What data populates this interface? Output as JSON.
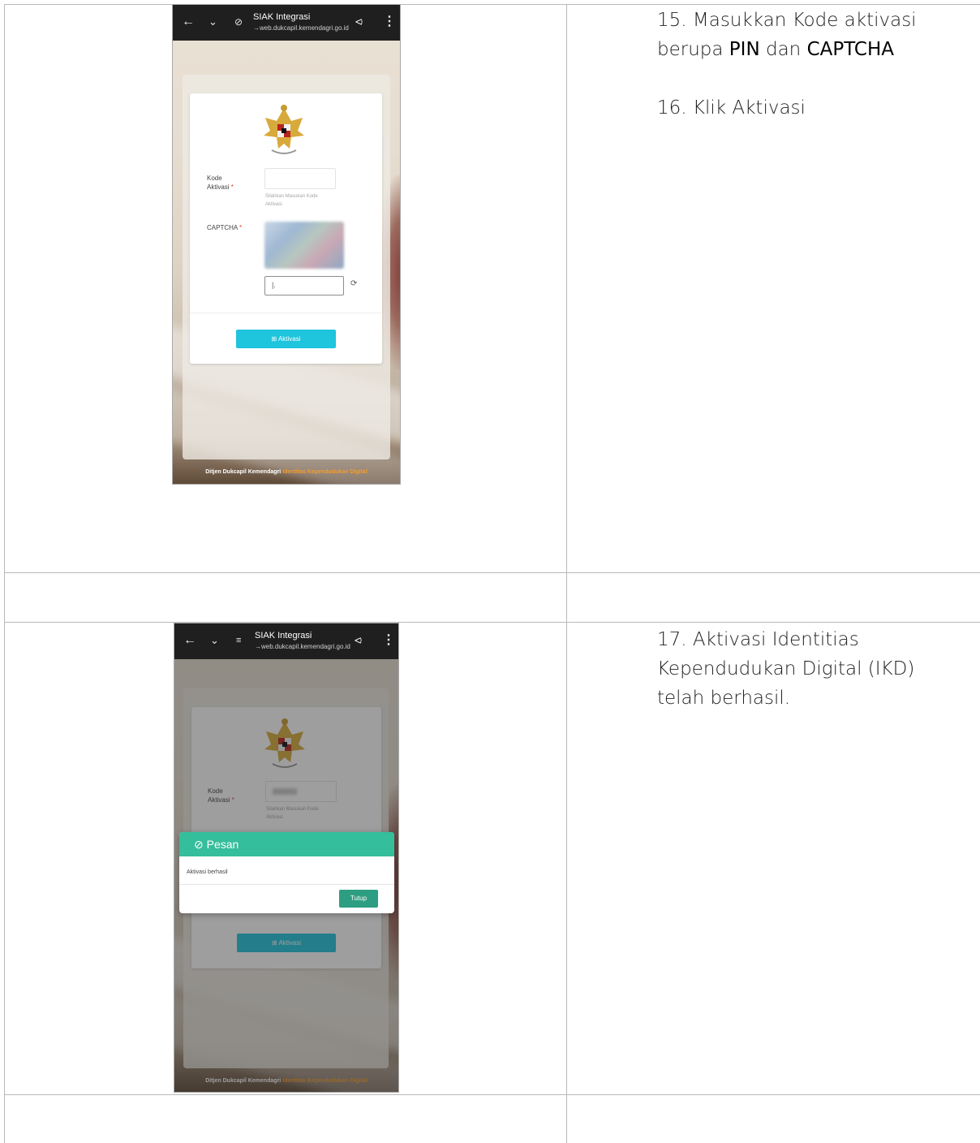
{
  "steps": {
    "s15_prefix": "15. Masukkan Kode aktivasi",
    "s15_line2_a": "berupa",
    "s15_pin": "PIN",
    "s15_and": "dan",
    "s15_captcha": "CAPTCHA",
    "s16": "16. Klik Aktivasi",
    "s17_line1": "17. Aktivasi Identitias",
    "s17_line2": "Kependudukan Digital (IKD)",
    "s17_line3": "telah berhasil."
  },
  "browser": {
    "title": "SIAK Integrasi",
    "url": "→web.dukcapil.kemendagri.go.id",
    "back_icon": "arrow-left-icon",
    "down_icon": "chevron-down-icon",
    "share_icon": "share-icon",
    "menu_icon": "kebab-menu-icon"
  },
  "form": {
    "kode_label_1": "Kode",
    "kode_label_2": "Aktivasi",
    "required_mark": "*",
    "kode_help_1": "Silahkan Masukan Kode",
    "kode_help_2": "Aktivasi",
    "captcha_label": "CAPTCHA",
    "captcha_input_value": "|.",
    "submit_label": "⊞ Aktivasi"
  },
  "footer": {
    "org": "Ditjen Dukcapil Kemendagri",
    "tagline": "Identitas Kependudukan Digital"
  },
  "dialog": {
    "title": "⊘ Pesan",
    "message": "Aktivasi berhasil",
    "close_label": "Tutup"
  },
  "colors": {
    "primary_button": "#1fc4dd",
    "dialog_header": "#35be9b",
    "close_button": "#2e9e82",
    "footer_accent": "#f59b2a",
    "required": "#e53935"
  }
}
